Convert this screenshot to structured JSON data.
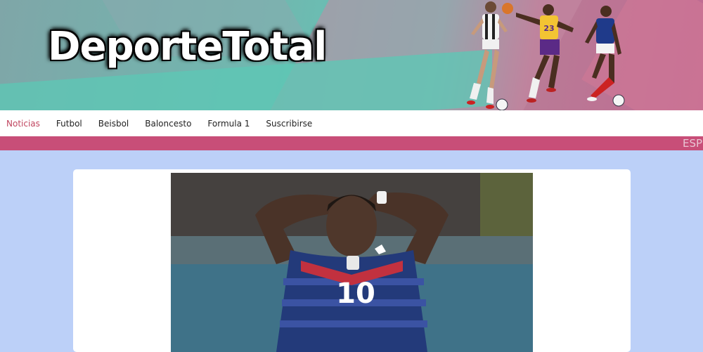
{
  "header": {
    "logo_text": "DeporteTotal",
    "banner_image": "athletes-collage"
  },
  "nav": {
    "items": [
      {
        "label": "Noticias",
        "active": true
      },
      {
        "label": "Futbol",
        "active": false
      },
      {
        "label": "Beisbol",
        "active": false
      },
      {
        "label": "Baloncesto",
        "active": false
      },
      {
        "label": "Formula 1",
        "active": false
      },
      {
        "label": "Suscribirse",
        "active": false
      }
    ]
  },
  "ticker": {
    "text": "ESP"
  },
  "main": {
    "featured_image": "player-number-10-hands-on-head",
    "jersey_number": "10",
    "player_number_on_banner": "23"
  },
  "colors": {
    "background": "#bcd0f8",
    "accent": "#c84e78",
    "active_nav": "#c0455f",
    "banner_teal": "#5ec7b8"
  }
}
